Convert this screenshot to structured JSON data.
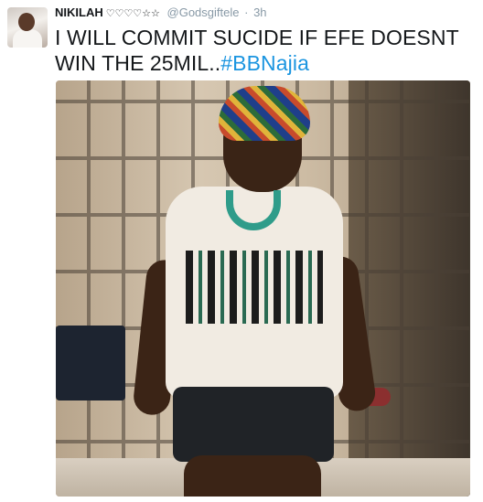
{
  "tweet": {
    "display_name": "NIKILAH",
    "name_emojis": "♡♡♡♡☆☆",
    "handle": "@Godsgiftele",
    "separator": "·",
    "timestamp": "3h",
    "text_main": "I WILL COMMIT SUCIDE IF EFE DOESNT WIN THE 25MIL..",
    "hashtag": "#BBNajia"
  },
  "colors": {
    "text": "#14171a",
    "muted": "#8899a6",
    "link": "#1b95e0"
  },
  "icons": {
    "avatar": "user-avatar-photo",
    "media": "tweet-photo"
  }
}
